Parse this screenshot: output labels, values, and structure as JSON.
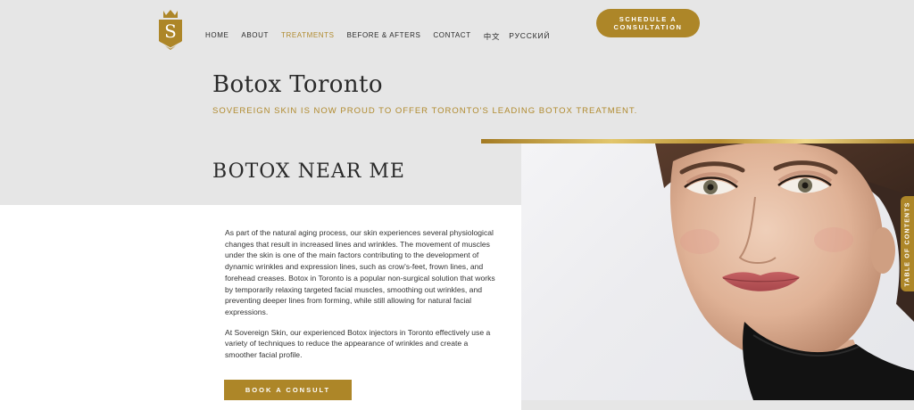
{
  "header": {
    "logo_letter": "S",
    "nav": [
      {
        "label": "HOME"
      },
      {
        "label": "ABOUT"
      },
      {
        "label": "TREATMENTS",
        "active": true
      },
      {
        "label": "BEFORE & AFTERS"
      },
      {
        "label": "CONTACT"
      },
      {
        "label": "中文"
      },
      {
        "label": "РУССКИЙ"
      }
    ],
    "cta_line1": "SCHEDULE A",
    "cta_line2": "CONSULTATION"
  },
  "hero": {
    "title": "Botox Toronto",
    "subtitle": "SOVEREIGN SKIN IS NOW PROUD TO OFFER TORONTO'S LEADING BOTOX TREATMENT."
  },
  "section": {
    "heading": "BOTOX NEAR ME",
    "paragraphs": [
      "As part of the natural aging process, our skin experiences several physiological changes that result in increased lines and wrinkles. The movement of muscles under the skin is one of the main factors contributing to the development of dynamic wrinkles and expression lines, such as crow's-feet, frown lines, and forehead creases. Botox in Toronto is a popular non-surgical solution that works by temporarily relaxing targeted facial muscles, smoothing out wrinkles, and preventing deeper lines from forming, while still allowing for natural facial expressions.",
      "At Sovereign Skin, our experienced Botox injectors in Toronto effectively use a variety of techniques to reduce the appearance of wrinkles and create a smoother facial profile."
    ],
    "button_label": "BOOK A CONSULT"
  },
  "toc_label": "TABLE OF CONTENTS",
  "colors": {
    "gold": "#ad8628",
    "background": "#e6e6e6"
  }
}
